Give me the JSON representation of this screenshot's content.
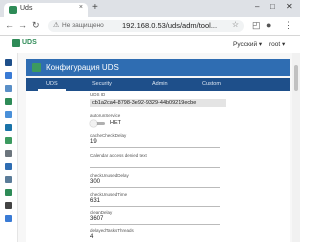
{
  "browser": {
    "tab_title": "Uds",
    "new_tab": "+",
    "tab_close": "×",
    "win_minimize": "–",
    "win_maximize": "□",
    "win_close": "✕",
    "nav_back": "←",
    "nav_forward": "→",
    "nav_reload": "↻",
    "security_text": "Не защищено",
    "url": "192.168.0.53/uds/adm/tool...",
    "star": "☆",
    "menu": "⋮"
  },
  "app": {
    "logo_text": "UDS",
    "language": "Русский ▾",
    "user": "root ▾"
  },
  "card": {
    "title": "Конфигурация UDS"
  },
  "tabs": [
    {
      "label": "UDS",
      "active": true
    },
    {
      "label": "Security",
      "active": false
    },
    {
      "label": "Admin",
      "active": false
    },
    {
      "label": "Custom",
      "active": false
    }
  ],
  "fields": [
    {
      "label": "UDS ID",
      "value": "cb1a2ca4-8798-3e92-9329-44b09219ecbe",
      "kind": "readonly"
    },
    {
      "label": "autorunService",
      "value": "НЕТ",
      "kind": "toggle"
    },
    {
      "label": "cacheCheckDelay",
      "value": "19",
      "kind": "text"
    },
    {
      "label": "Calendar access denied text",
      "value": "",
      "kind": "text"
    },
    {
      "label": "checkUnusedDelay",
      "value": "300",
      "kind": "text"
    },
    {
      "label": "checkUnusedTime",
      "value": "631",
      "kind": "text"
    },
    {
      "label": "cleanDelay",
      "value": "3607",
      "kind": "text"
    },
    {
      "label": "delayedTasksThreads",
      "value": "4",
      "kind": "text"
    }
  ],
  "colors": {
    "accent": "#2f6db2",
    "tabs_bar": "#1e4f8a",
    "brand_green": "#2e8b57"
  }
}
